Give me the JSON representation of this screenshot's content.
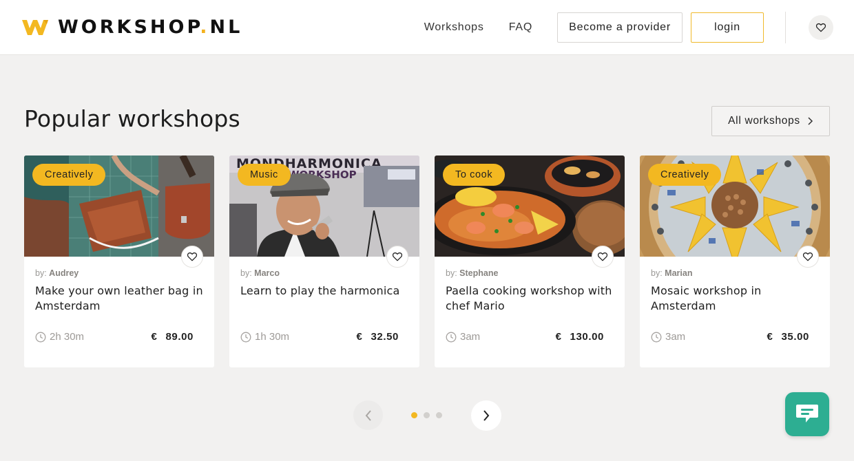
{
  "header": {
    "logo_text": "WORKSHOP",
    "logo_dot": ".",
    "logo_suffix": "NL",
    "nav": [
      "Workshops",
      "FAQ"
    ],
    "provider_label": "Become a provider",
    "login_label": "login",
    "brand_color": "#f3b821"
  },
  "section": {
    "title": "Popular workshops",
    "all_label": "All workshops"
  },
  "cards": [
    {
      "category": "Creatively",
      "by_prefix": "by:",
      "provider": "Audrey",
      "title": "Make your own leather bag in Amsterdam",
      "duration": "2h 30m",
      "currency": "€",
      "price": "89.00"
    },
    {
      "category": "Music",
      "by_prefix": "by:",
      "provider": "Marco",
      "title": "Learn to play the harmonica",
      "duration": "1h 30m",
      "currency": "€",
      "price": "32.50"
    },
    {
      "category": "To cook",
      "by_prefix": "by:",
      "provider": "Stephane",
      "title": "Paella cooking workshop with chef Mario",
      "duration": "3am",
      "currency": "€",
      "price": "130.00"
    },
    {
      "category": "Creatively",
      "by_prefix": "by:",
      "provider": "Marian",
      "title": "Mosaic workshop in Amsterdam",
      "duration": "3am",
      "currency": "€",
      "price": "35.00"
    }
  ],
  "pager": {
    "pages": 3,
    "active": 1
  },
  "chat": {
    "color": "#2dae92"
  }
}
